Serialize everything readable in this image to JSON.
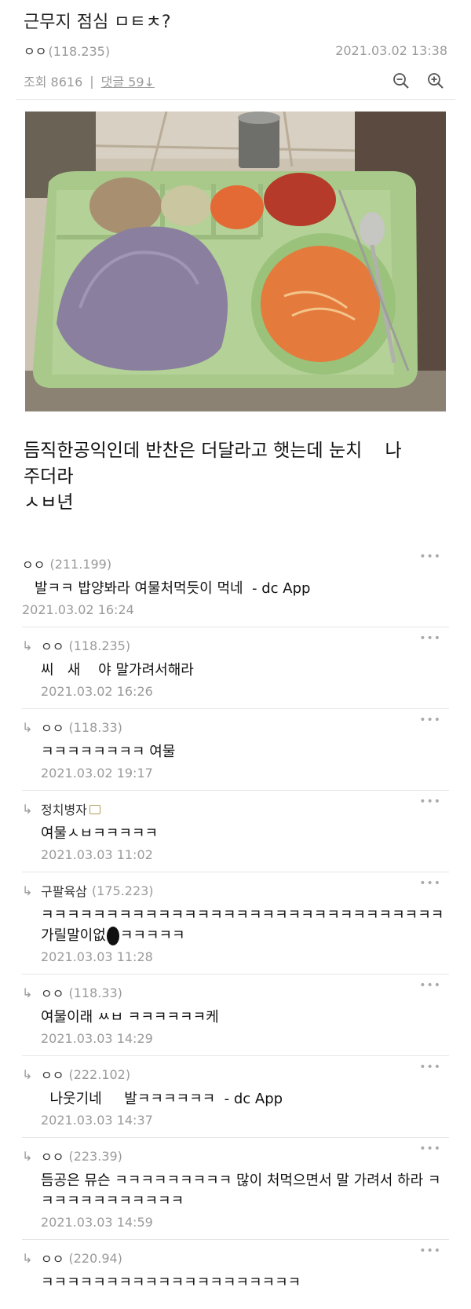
{
  "post": {
    "title": "근무지 점심 ㅁㅌㅊ?",
    "author": "ㅇㅇ",
    "author_ip": "(118.235)",
    "datetime": "2021.03.02 13:38",
    "views_label": "조회 8616",
    "comments_label": "댓글 59",
    "comments_arrow": "↓",
    "body_lines": [
      "듬직한공익인데 반찬은 더달라고 햇는데 눈치    나",
      "주더라",
      "ㅅㅂ년"
    ],
    "zoom_out_icon": "zoom-out-icon",
    "zoom_in_icon": "zoom-in-icon"
  },
  "comments": [
    {
      "reply": false,
      "author": "ㅇㅇ",
      "ip": "(211.199)",
      "text": "발ㅋㅋ 밥양봐라 여물처먹듯이 먹네  - dc App",
      "date": "2021.03.02 16:24"
    },
    {
      "reply": true,
      "author": "ㅇㅇ",
      "ip": "(118.235)",
      "text": "씨   새    야 말가려서해라",
      "date": "2021.03.02 16:26"
    },
    {
      "reply": true,
      "author": "ㅇㅇ",
      "ip": "(118.33)",
      "text": "ㅋㅋㅋㅋㅋㅋㅋㅋ 여물",
      "date": "2021.03.02 19:17"
    },
    {
      "reply": true,
      "author": "정치병자",
      "ip": "",
      "badge": true,
      "text": "여물ㅅㅂㅋㅋㅋㅋㅋ",
      "date": "2021.03.03 11:02"
    },
    {
      "reply": true,
      "author": "구팔육삼",
      "ip": "(175.223)",
      "text_before": "ㅋㅋㅋㅋㅋㅋㅋㅋㅋㅋㅋㅋㅋㅋㅋㅋㅋㅋㅋㅋㅋㅋㅋㅋㅋㅋㅋㅋㅋㅋㅋ가릴말이없",
      "text_after": "ㅋㅋㅋㅋㅋ",
      "date": "2021.03.03 11:28"
    },
    {
      "reply": true,
      "author": "ㅇㅇ",
      "ip": "(118.33)",
      "text": "여물이래 ㅆㅂ ㅋㅋㅋㅋㅋㅋ케",
      "date": "2021.03.03 14:29"
    },
    {
      "reply": true,
      "author": "ㅇㅇ",
      "ip": "(222.102)",
      "text": "  나웃기네     발ㅋㅋㅋㅋㅋㅋ  - dc App",
      "date": "2021.03.03 14:37"
    },
    {
      "reply": true,
      "author": "ㅇㅇ",
      "ip": "(223.39)",
      "text": "듬공은 뮤슨 ㅋㅋㅋㅋㅋㅋㅋㅋㅋ 많이 처먹으면서 말 가려서 하라 ㅋㅋㅋㅋㅋㅋㅋㅋㅋㅋㅋㅋ",
      "date": "2021.03.03 14:59"
    },
    {
      "reply": true,
      "author": "ㅇㅇ",
      "ip": "(220.94)",
      "text": "ㅋㅋㅋㅋㅋㅋㅋㅋㅋㅋㅋㅋㅋㅋㅋㅋㅋㅋㅋㅋ",
      "date": ""
    }
  ],
  "colors": {
    "meta_grey": "#9a9a9a",
    "divider": "#e6e6e6",
    "tray_green": "#a9c98b",
    "rice_purple": "#8a7f9f",
    "soup_orange": "#e47a3b"
  }
}
